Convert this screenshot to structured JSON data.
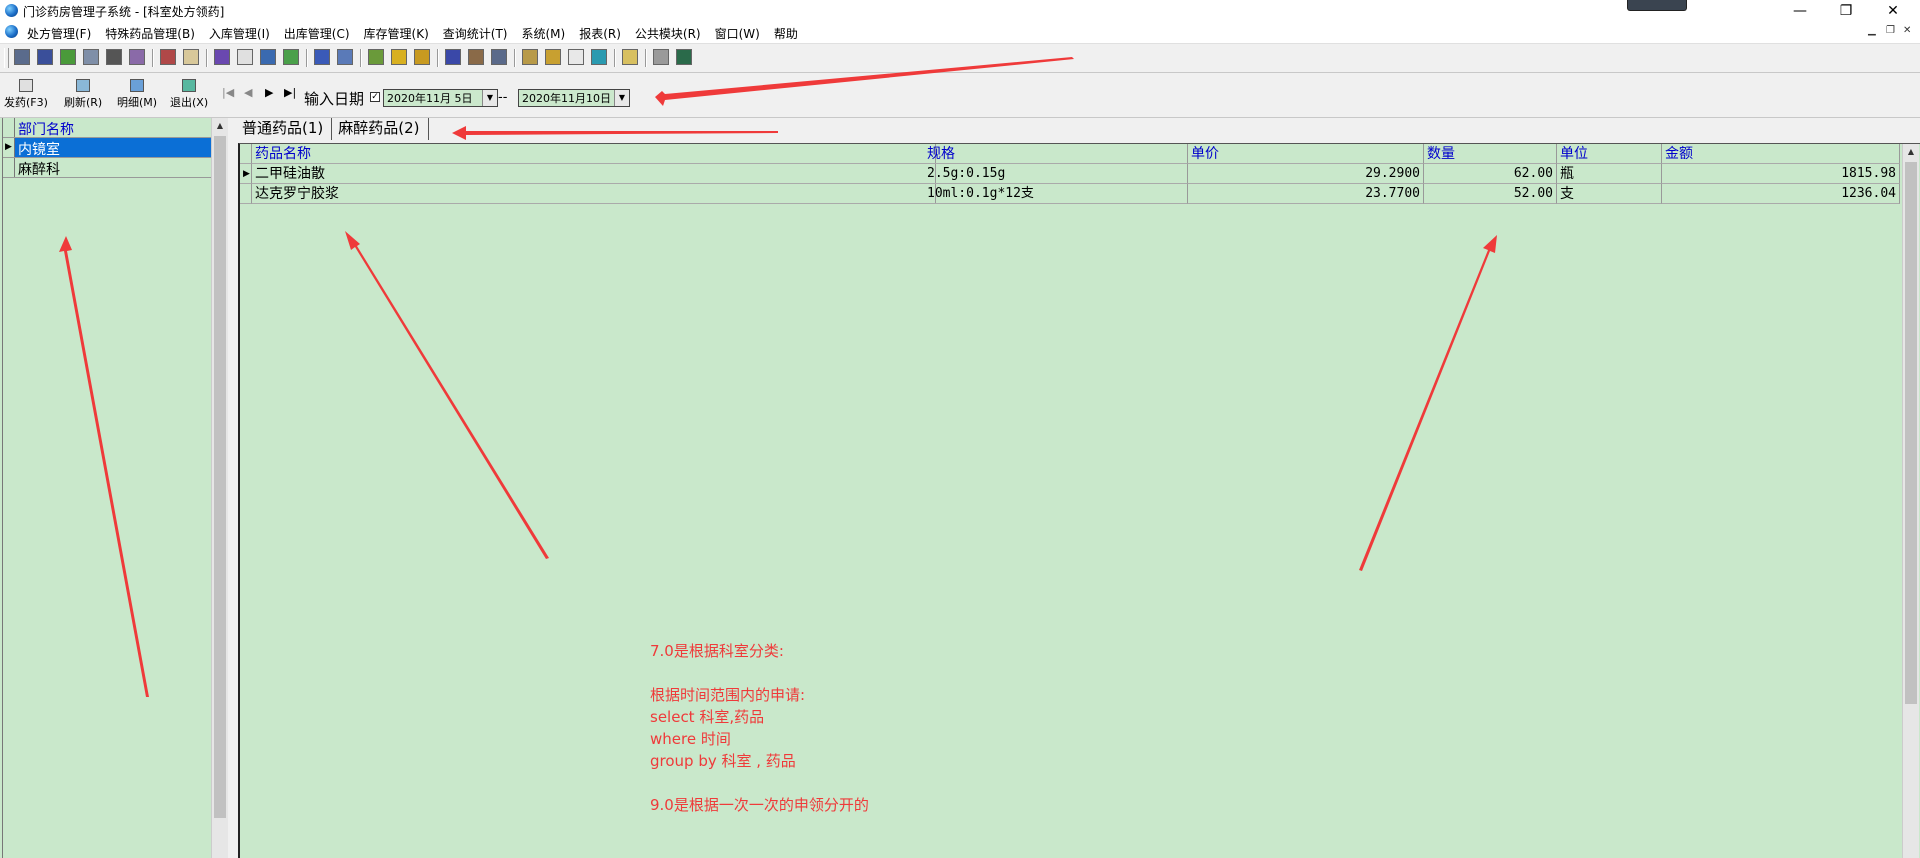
{
  "window": {
    "title": "门诊药房管理子系统 - [科室处方领药]",
    "controls": {
      "minimize": "—",
      "maximize": "❐",
      "close": "✕"
    }
  },
  "menu": [
    "处方管理(F)",
    "特殊药品管理(B)",
    "入库管理(I)",
    "出库管理(C)",
    "库存管理(K)",
    "查询统计(T)",
    "系统(M)",
    "报表(R)",
    "公共模块(R)",
    "窗口(W)",
    "帮助"
  ],
  "actions": {
    "dispense": "发药(F3)",
    "refresh": "刷新(R)",
    "detail": "明细(M)",
    "exit": "退出(X)"
  },
  "nav": {
    "first": "|◀",
    "prev": "◀",
    "next": "▶",
    "last": "▶|"
  },
  "date_filter": {
    "label": "输入日期",
    "checked": true,
    "check_mark": "✓",
    "from": "2020年11月 5日",
    "to": "2020年11月10日",
    "separator": "--"
  },
  "departments": {
    "header": "部门名称",
    "items": [
      {
        "name": "内镜室",
        "selected": true
      },
      {
        "name": "麻醉科",
        "selected": false
      }
    ]
  },
  "tabs": [
    "普通药品(1)",
    "麻醉药品(2)"
  ],
  "drug_table": {
    "columns": [
      "药品名称",
      "规格",
      "单价",
      "数量",
      "单位",
      "金额"
    ],
    "rows": [
      [
        "二甲硅油散",
        "2.5g:0.15g",
        "29.2900",
        "62.00",
        "瓶",
        "1815.98"
      ],
      [
        "达克罗宁胶浆",
        "10ml:0.1g*12支",
        "23.7700",
        "52.00",
        "支",
        "1236.04"
      ]
    ]
  },
  "annotation": {
    "color": "#ef3a3a",
    "lines": [
      "7.0是根据科室分类:",
      "",
      "根据时间范围内的申请:",
      "select 科室,药品",
      "where 时间",
      "group by 科室 , 药品",
      "",
      "9.0是根据一次一次的申领分开的"
    ]
  },
  "colors": {
    "grid_bg": "#c9e8cb",
    "selection": "#0b6fd6",
    "header_text": "#0000cc"
  }
}
